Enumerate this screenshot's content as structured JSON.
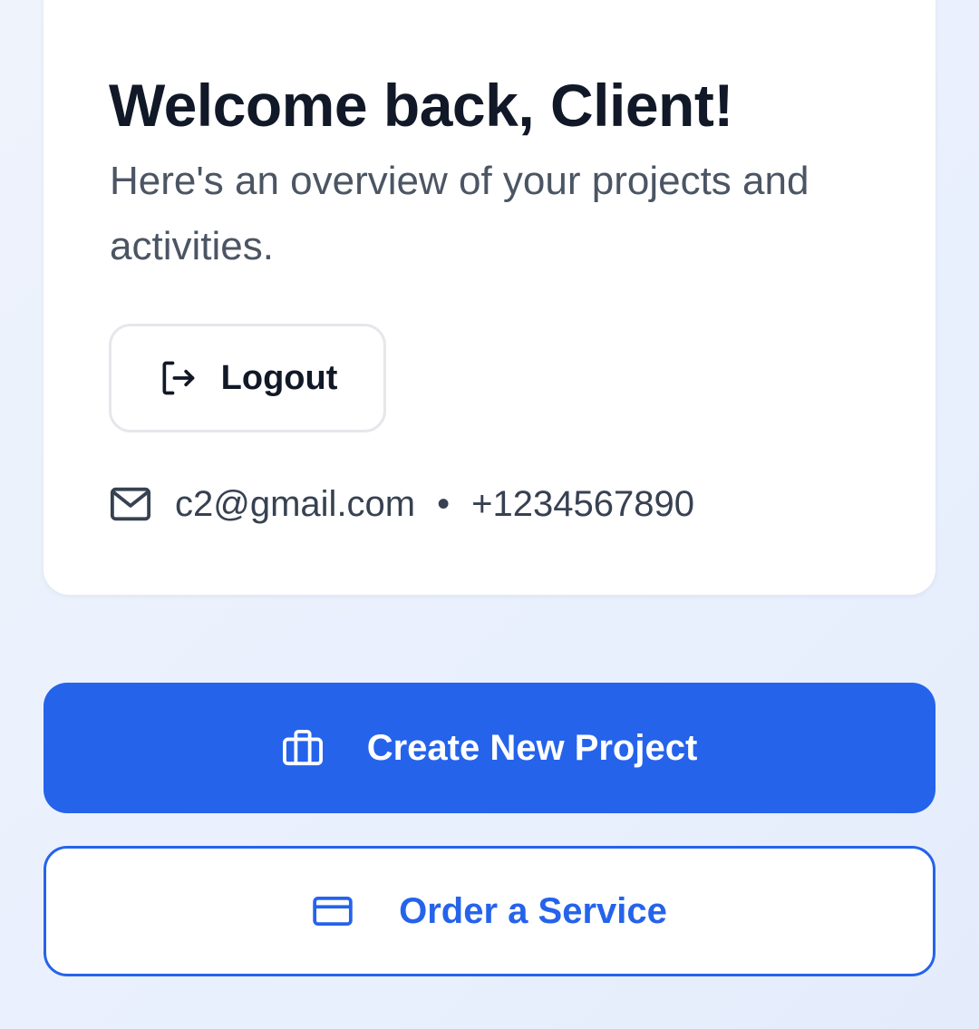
{
  "welcome": {
    "title": "Welcome back, Client!",
    "subtitle": "Here's an overview of your projects and activities."
  },
  "logout": {
    "label": "Logout",
    "icon": "logout-icon"
  },
  "contact": {
    "email": "c2@gmail.com",
    "separator": "•",
    "phone": "+1234567890",
    "icon": "mail-icon"
  },
  "actions": {
    "create_project": {
      "label": "Create New Project",
      "icon": "briefcase-icon"
    },
    "order_service": {
      "label": "Order a Service",
      "icon": "credit-card-icon"
    }
  },
  "colors": {
    "primary": "#2563eb",
    "title_text": "#111827",
    "subtitle_text": "#4b5563",
    "card_background": "#ffffff",
    "page_background": "#eef3fc"
  }
}
